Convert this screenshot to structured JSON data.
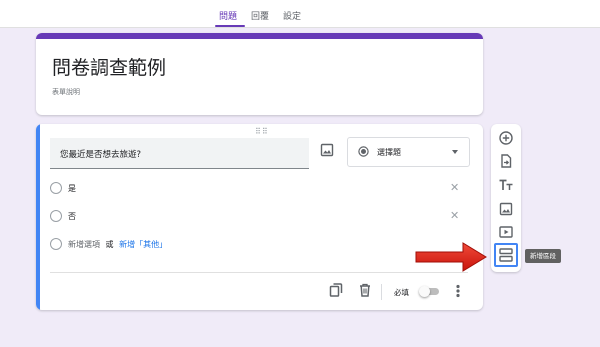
{
  "tabs": [
    {
      "label": "問題",
      "active": true
    },
    {
      "label": "回覆",
      "active": false
    },
    {
      "label": "設定",
      "active": false
    }
  ],
  "form": {
    "title": "問卷調查範例",
    "description": "表單說明"
  },
  "question": {
    "text": "您最近是否想去旅遊?",
    "type_label": "選擇題",
    "options": [
      "是",
      "否"
    ],
    "add_option_label": "新增選項",
    "or_label": "或",
    "add_other_label": "新增「其他」",
    "required_label": "必填",
    "required": false
  },
  "toolbar": {
    "tooltip": "新增區段",
    "items": [
      "add-question",
      "import-questions",
      "add-title",
      "add-image",
      "add-video",
      "add-section"
    ]
  },
  "colors": {
    "accent": "#673ab7",
    "active_bar": "#4285f4",
    "arrow": "#e2231a",
    "background": "#f0ebf8"
  }
}
